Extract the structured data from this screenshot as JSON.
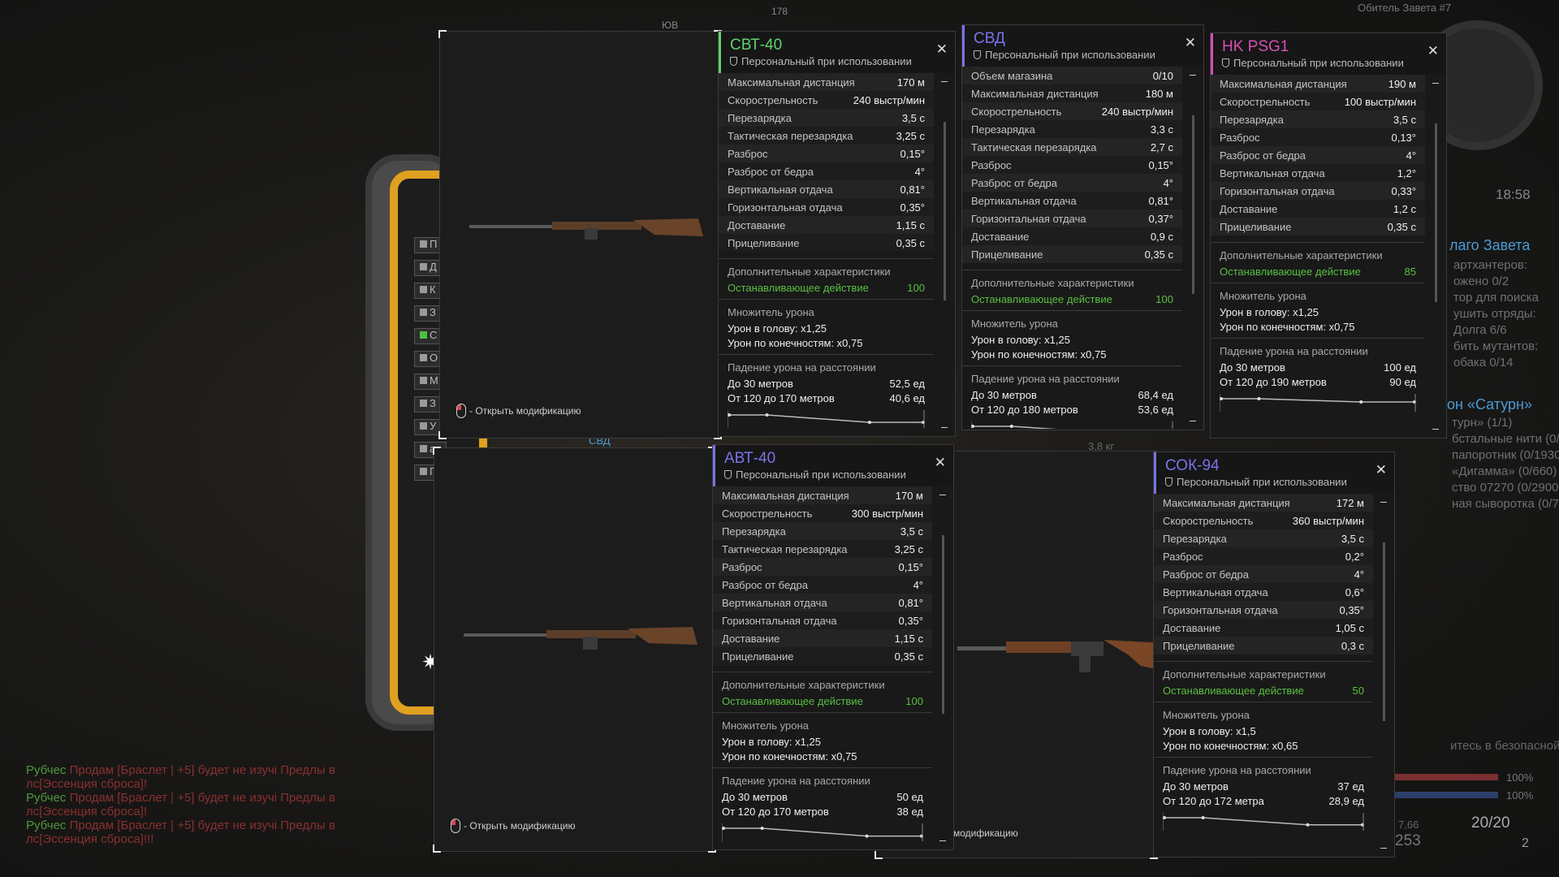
{
  "background": {
    "top_right": "Обитель Завета #7",
    "compass_n": "178",
    "compass_nw": "ЮВ",
    "time": "18:58",
    "quest_title": "лаго Завета",
    "quest_lines": [
      "артхантеров:",
      "ожено 0/2",
      "тор для поиска",
      "ушить отряды:",
      "Долга 6/6",
      "бить мутантов:",
      "обака 0/14"
    ],
    "quest2_title": "он «Сатурн»",
    "quest2_lines": [
      "турн» (1/1)",
      "бстальные нити (0/3360)",
      "папоротник (0/1930)",
      "«Дигамма» (0/660)",
      "ство 07270 (0/2900)",
      "ная сыворотка (0/75)"
    ],
    "safe_zone": "итесь в безопасной зоне",
    "bars": [
      "100%",
      "100%"
    ],
    "ammo": "20/20",
    "ammo_reserve": "253",
    "grenades": "2",
    "weight": "3,8 кг",
    "weight2": "7,66",
    "side_rows": [
      "П",
      "Д",
      "К",
      "З",
      "С",
      "О",
      "М",
      "З",
      "У",
      "а",
      "Г"
    ],
    "side_label": "СВД"
  },
  "chat": [
    {
      "name": "Рубчес",
      "text": "Продам [Браслет | +5] будет не изучі Предлы в",
      "end": "лс[Эссенция сброса]!"
    },
    {
      "name": "Рубчес",
      "text": "Продам [Браслет | +5] будет не изучі Предлы в",
      "end": "лс[Эссенция сброса]!"
    },
    {
      "name": "Рубчес",
      "text": "Продам [Браслет | +5] будет не изучі Предлы в",
      "end": "лс[Эссенция сброса]!!!"
    }
  ],
  "mod_hint": "- Открыть модификацию",
  "mod_hint_partial": "модификацию",
  "cards": {
    "svt40": {
      "title": "СВТ-40",
      "subtitle": "Персональный при использовании",
      "color": "#5fd46a",
      "stats": [
        [
          "Максимальная дистанция",
          "170 м"
        ],
        [
          "Скорострельность",
          "240 выстр/мин"
        ],
        [
          "Перезарядка",
          "3,5 с"
        ],
        [
          "Тактическая перезарядка",
          "3,25 с"
        ],
        [
          "Разброс",
          "0,15°"
        ],
        [
          "Разброс от бедра",
          "4°"
        ],
        [
          "Вертикальная отдача",
          "0,81°"
        ],
        [
          "Горизонтальная отдача",
          "0,35°"
        ],
        [
          "Доставание",
          "1,15 с"
        ],
        [
          "Прицеливание",
          "0,35 с"
        ]
      ],
      "extra_title": "Дополнительные характеристики",
      "extra": [
        "Останавливающее действие",
        "100"
      ],
      "mult_title": "Множитель урона",
      "mult": [
        "Урон в голову: x1,25",
        "Урон по конечностям: x0,75"
      ],
      "falloff_title": "Падение урона на расстоянии",
      "falloff": [
        [
          "До 30 метров",
          "52,5 ед"
        ],
        [
          "От 120 до 170 метров",
          "40,6 ед"
        ]
      ]
    },
    "svd": {
      "title": "СВД",
      "subtitle": "Персональный при использовании",
      "color": "#7a72e8",
      "stats": [
        [
          "Объем магазина",
          "0/10"
        ],
        [
          "Максимальная дистанция",
          "180 м"
        ],
        [
          "Скорострельность",
          "240 выстр/мин"
        ],
        [
          "Перезарядка",
          "3,3 с"
        ],
        [
          "Тактическая перезарядка",
          "2,7 с"
        ],
        [
          "Разброс",
          "0,15°"
        ],
        [
          "Разброс от бедра",
          "4°"
        ],
        [
          "Вертикальная отдача",
          "0,81°"
        ],
        [
          "Горизонтальная отдача",
          "0,37°"
        ],
        [
          "Доставание",
          "0,9 с"
        ],
        [
          "Прицеливание",
          "0,35 с"
        ]
      ],
      "extra_title": "Дополнительные характеристики",
      "extra": [
        "Останавливающее действие",
        "100"
      ],
      "mult_title": "Множитель урона",
      "mult": [
        "Урон в голову: x1,25",
        "Урон по конечностям: x0,75"
      ],
      "falloff_title": "Падение урона на расстоянии",
      "falloff": [
        [
          "До 30 метров",
          "68,4 ед"
        ],
        [
          "От 120 до 180 метров",
          "53,6 ед"
        ]
      ]
    },
    "psg1": {
      "title": "HK PSG1",
      "subtitle": "Персональный при использовании",
      "color": "#d44fb8",
      "stats": [
        [
          "Максимальная дистанция",
          "190 м"
        ],
        [
          "Скорострельность",
          "100 выстр/мин"
        ],
        [
          "Перезарядка",
          "3,5 с"
        ],
        [
          "Разброс",
          "0,13°"
        ],
        [
          "Разброс от бедра",
          "4°"
        ],
        [
          "Вертикальная отдача",
          "1,2°"
        ],
        [
          "Горизонтальная отдача",
          "0,33°"
        ],
        [
          "Доставание",
          "1,2 с"
        ],
        [
          "Прицеливание",
          "0,35 с"
        ]
      ],
      "extra_title": "Дополнительные характеристики",
      "extra": [
        "Останавливающее действие",
        "85"
      ],
      "mult_title": "Множитель урона",
      "mult": [
        "Урон в голову: x1,25",
        "Урон по конечностям: x0,75"
      ],
      "falloff_title": "Падение урона на расстоянии",
      "falloff": [
        [
          "До 30 метров",
          "100 ед"
        ],
        [
          "От 120 до 190 метров",
          "90 ед"
        ]
      ]
    },
    "avt40": {
      "title": "АВТ-40",
      "subtitle": "Персональный при использовании",
      "color": "#7a72e8",
      "stats": [
        [
          "Максимальная дистанция",
          "170 м"
        ],
        [
          "Скорострельность",
          "300 выстр/мин"
        ],
        [
          "Перезарядка",
          "3,5 с"
        ],
        [
          "Тактическая перезарядка",
          "3,25 с"
        ],
        [
          "Разброс",
          "0,15°"
        ],
        [
          "Разброс от бедра",
          "4°"
        ],
        [
          "Вертикальная отдача",
          "0,81°"
        ],
        [
          "Горизонтальная отдача",
          "0,35°"
        ],
        [
          "Доставание",
          "1,15 с"
        ],
        [
          "Прицеливание",
          "0,35 с"
        ]
      ],
      "extra_title": "Дополнительные характеристики",
      "extra": [
        "Останавливающее действие",
        "100"
      ],
      "mult_title": "Множитель урона",
      "mult": [
        "Урон в голову: x1,25",
        "Урон по конечностям: x0,75"
      ],
      "falloff_title": "Падение урона на расстоянии",
      "falloff": [
        [
          "До 30 метров",
          "50 ед"
        ],
        [
          "От 120 до 170 метров",
          "38 ед"
        ]
      ]
    },
    "sok94": {
      "title": "СОК-94",
      "subtitle": "Персональный при использовании",
      "color": "#7a72e8",
      "stats": [
        [
          "Максимальная дистанция",
          "172 м"
        ],
        [
          "Скорострельность",
          "360 выстр/мин"
        ],
        [
          "Перезарядка",
          "3,5 с"
        ],
        [
          "Разброс",
          "0,2°"
        ],
        [
          "Разброс от бедра",
          "4°"
        ],
        [
          "Вертикальная отдача",
          "0,6°"
        ],
        [
          "Горизонтальная отдача",
          "0,35°"
        ],
        [
          "Доставание",
          "1,05 с"
        ],
        [
          "Прицеливание",
          "0,3 с"
        ]
      ],
      "extra_title": "Дополнительные характеристики",
      "extra": [
        "Останавливающее действие",
        "50"
      ],
      "mult_title": "Множитель урона",
      "mult": [
        "Урон в голову: x1,5",
        "Урон по конечностям: x0,65"
      ],
      "falloff_title": "Падение урона на расстоянии",
      "falloff": [
        [
          "До 30 метров",
          "37 ед"
        ],
        [
          "От 120 до 172 метра",
          "28,9 ед"
        ]
      ]
    }
  }
}
